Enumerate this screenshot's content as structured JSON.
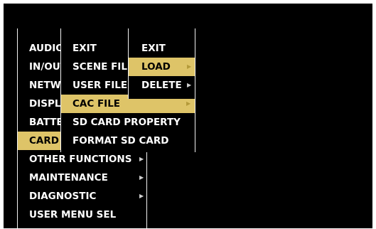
{
  "menu_level_1": {
    "items": [
      {
        "label": "AUDIO"
      },
      {
        "label": "IN/OUT"
      },
      {
        "label": "NETWORK"
      },
      {
        "label": "DISPLAY"
      },
      {
        "label": "BATTERY"
      },
      {
        "label": "CARD"
      },
      {
        "label": "OTHER FUNCTIONS",
        "arrow": "▶"
      },
      {
        "label": "MAINTENANCE",
        "arrow": "▶"
      },
      {
        "label": "DIAGNOSTIC",
        "arrow": "▶"
      },
      {
        "label": "USER MENU SEL"
      }
    ],
    "selected": "CARD"
  },
  "menu_level_2": {
    "items": [
      {
        "label": "EXIT"
      },
      {
        "label": "SCENE FILE"
      },
      {
        "label": "USER FILE"
      },
      {
        "label": "CAC FILE",
        "arrow": "▶"
      },
      {
        "label": "SD CARD PROPERTY"
      },
      {
        "label": "FORMAT SD CARD"
      }
    ],
    "selected": "CAC FILE"
  },
  "menu_level_3": {
    "items": [
      {
        "label": "EXIT"
      },
      {
        "label": "LOAD",
        "arrow": "▶"
      },
      {
        "label": "DELETE",
        "arrow": "▶"
      }
    ],
    "selected": "LOAD"
  },
  "colors": {
    "background": "#000000",
    "text": "#ffffff",
    "highlight": "#dec468",
    "border": "#f2f2f2"
  }
}
